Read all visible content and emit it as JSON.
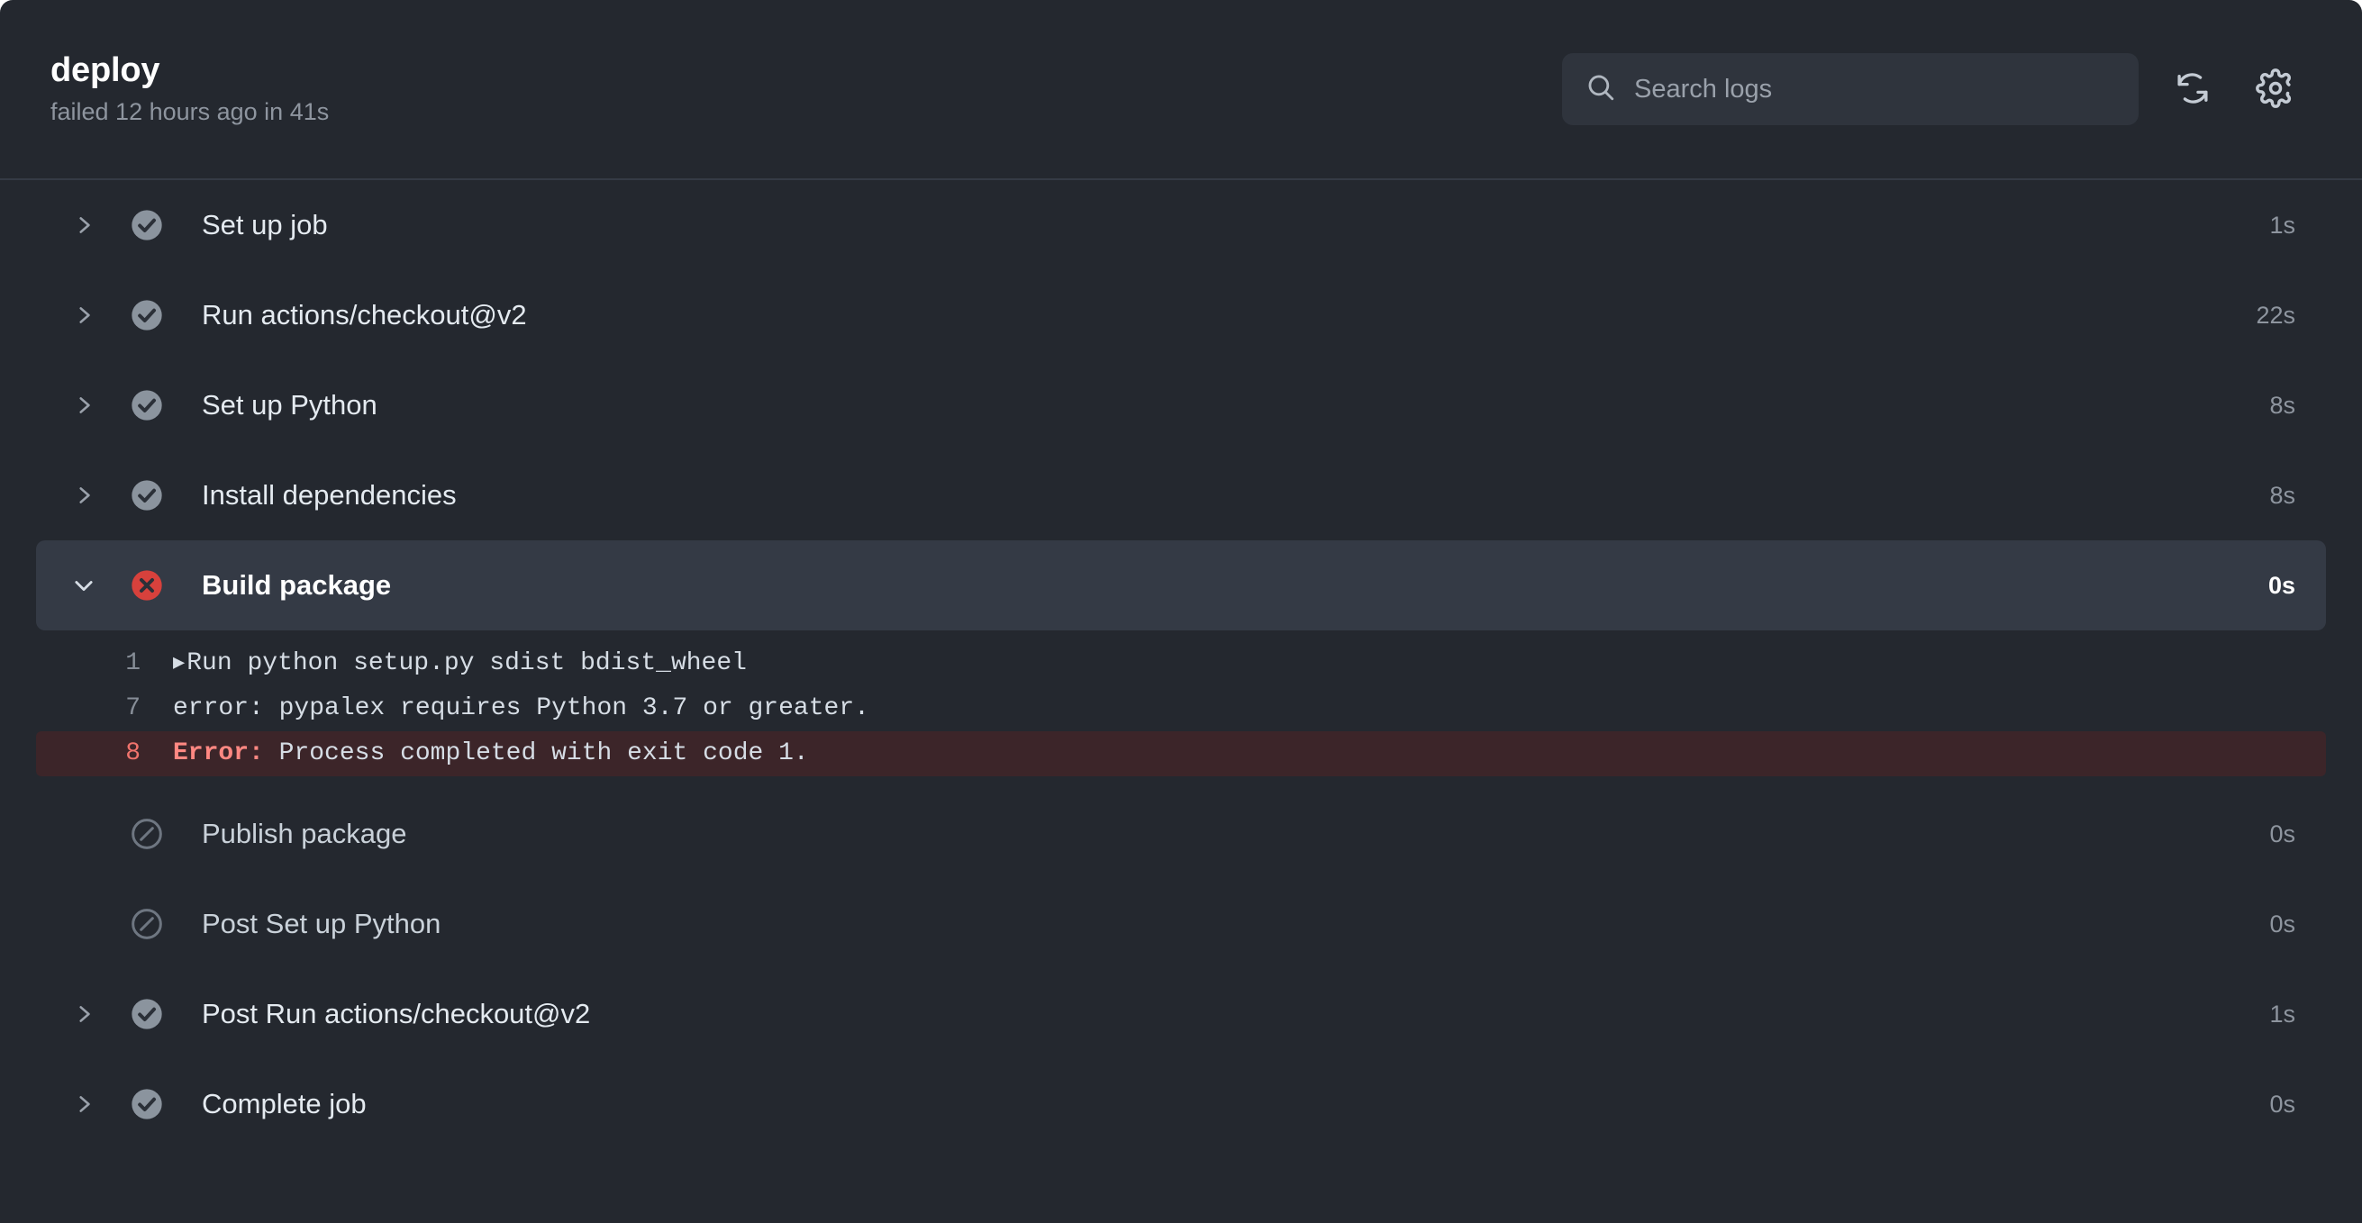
{
  "header": {
    "job_name": "deploy",
    "job_status": "failed 12 hours ago in 41s",
    "search": {
      "placeholder": "Search logs",
      "value": ""
    },
    "refresh_icon": "sync-icon",
    "settings_icon": "gear-icon"
  },
  "steps": [
    {
      "label": "Set up job",
      "duration": "1s",
      "state": "success",
      "toggle": "chevron-right"
    },
    {
      "label": "Run actions/checkout@v2",
      "duration": "22s",
      "state": "success",
      "toggle": "chevron-right"
    },
    {
      "label": "Set up Python",
      "duration": "8s",
      "state": "success",
      "toggle": "chevron-right"
    },
    {
      "label": "Install dependencies",
      "duration": "8s",
      "state": "success",
      "toggle": "chevron-right"
    },
    {
      "label": "Build package",
      "duration": "0s",
      "state": "failed",
      "toggle": "chevron-down"
    },
    {
      "label": "Publish package",
      "duration": "0s",
      "state": "skipped",
      "toggle": "none"
    },
    {
      "label": "Post Set up Python",
      "duration": "0s",
      "state": "skipped",
      "toggle": "none"
    },
    {
      "label": "Post Run actions/checkout@v2",
      "duration": "1s",
      "state": "success",
      "toggle": "chevron-right"
    },
    {
      "label": "Complete job",
      "duration": "0s",
      "state": "success",
      "toggle": "chevron-right"
    }
  ],
  "log": {
    "lines": [
      {
        "number": "1",
        "marker": "▶",
        "text": "Run python setup.py sdist bdist_wheel",
        "error": false,
        "prefix": ""
      },
      {
        "number": "7",
        "marker": "",
        "text": "error: pypalex requires Python 3.7 or greater.",
        "error": false,
        "prefix": ""
      },
      {
        "number": "8",
        "marker": "",
        "text": "Process completed with exit code 1.",
        "error": true,
        "prefix": "Error:"
      }
    ]
  },
  "colors": {
    "panel_bg": "#24282f",
    "header_border": "#353b45",
    "failed_row_bg": "#343a45",
    "error_line_bg": "#3c2529",
    "success_icon": "#8b949e",
    "failed_icon": "#d7413c",
    "skipped_icon": "#6e7681",
    "error_text": "#ff8882",
    "muted_text": "#8e959f"
  }
}
